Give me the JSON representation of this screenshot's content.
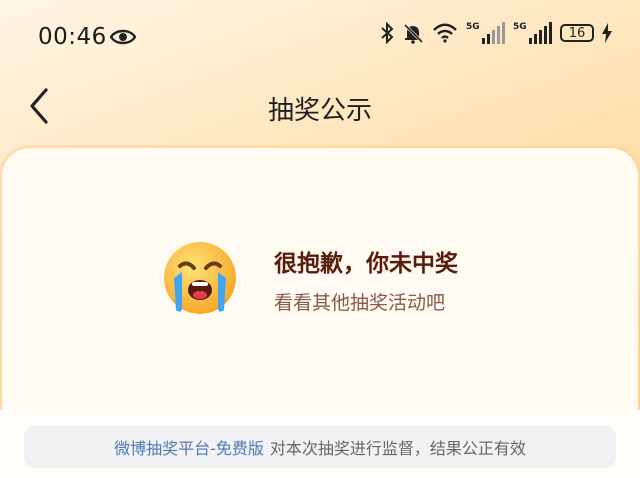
{
  "status_bar": {
    "time": "00:46",
    "signal1_label": "5G",
    "signal2_label": "5G",
    "battery": "16"
  },
  "header": {
    "title": "抽奖公示"
  },
  "result": {
    "title": "很抱歉，你未中奖",
    "subtitle": "看看其他抽奖活动吧"
  },
  "footer": {
    "platform_link": "微博抽奖平台-免费版",
    "notice_text": "对本次抽奖进行监督，结果公正有效"
  }
}
